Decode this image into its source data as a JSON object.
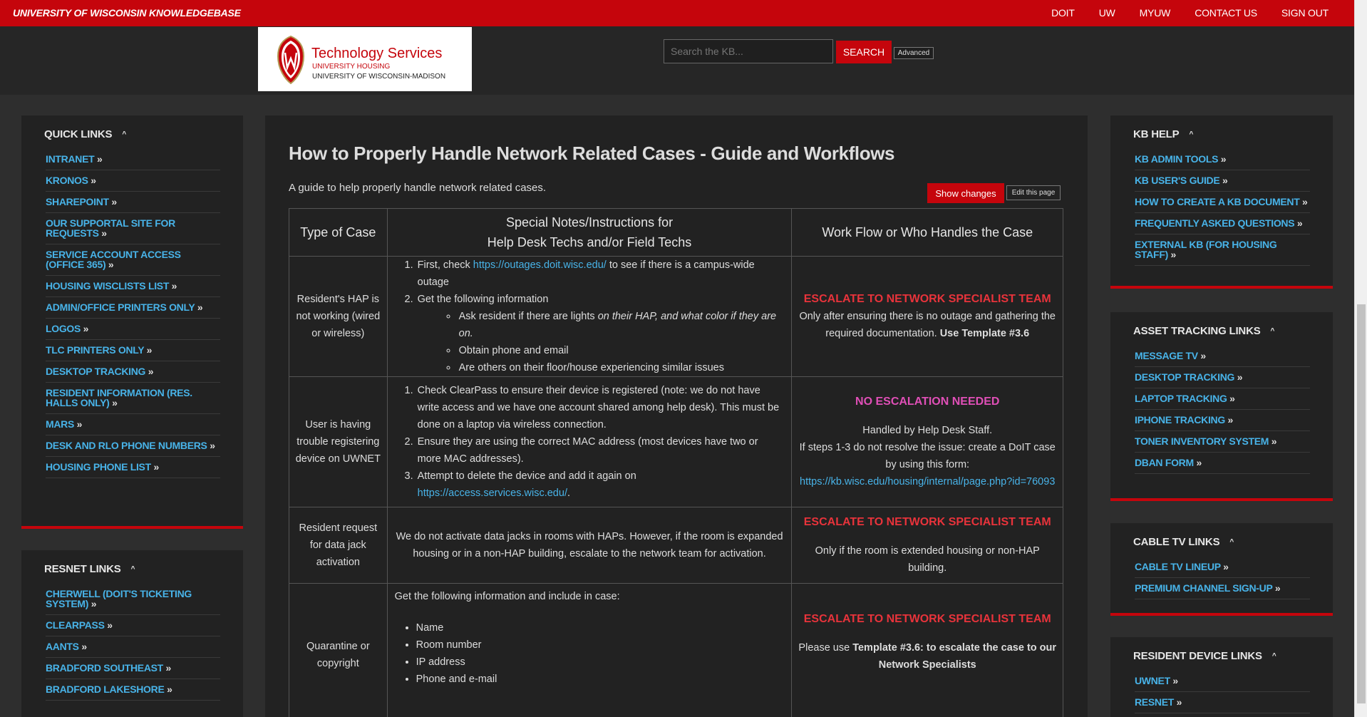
{
  "topbar": {
    "brand": "UNIVERSITY OF WISCONSIN KNOWLEDGEBASE",
    "nav": [
      "DOIT",
      "UW",
      "MYUW",
      "CONTACT US",
      "SIGN OUT"
    ]
  },
  "logo": {
    "line1": "Technology Services",
    "line2": "UNIVERSITY HOUSING",
    "line3": "UNIVERSITY OF WISCONSIN-MADISON"
  },
  "search": {
    "placeholder": "Search the KB...",
    "button": "SEARCH",
    "advanced": "Advanced"
  },
  "left": {
    "quick": {
      "title": "QUICK LINKS",
      "items": [
        "INTRANET",
        "KRONOS",
        "SHAREPOINT",
        "OUR SUPPORTAL SITE FOR REQUESTS",
        "SERVICE ACCOUNT ACCESS (OFFICE 365)",
        "HOUSING WISCLISTS LIST",
        "ADMIN/OFFICE PRINTERS ONLY",
        "LOGOS",
        "TLC PRINTERS ONLY",
        "DESKTOP TRACKING",
        "RESIDENT INFORMATION (RES. HALLS ONLY)",
        "MARS",
        "DESK AND RLO PHONE NUMBERS",
        "HOUSING PHONE LIST"
      ]
    },
    "resnet": {
      "title": "RESNET LINKS",
      "items": [
        "CHERWELL (DOIT'S TICKETING SYSTEM)",
        "CLEARPASS",
        "AANTS",
        "BRADFORD SOUTHEAST",
        "BRADFORD LAKESHORE"
      ]
    }
  },
  "right": {
    "kbhelp": {
      "title": "KB HELP",
      "items": [
        "KB ADMIN TOOLS",
        "KB USER'S GUIDE",
        "HOW TO CREATE A KB DOCUMENT",
        "FREQUENTLY ASKED QUESTIONS",
        "EXTERNAL KB (FOR HOUSING STAFF)"
      ]
    },
    "asset": {
      "title": "ASSET TRACKING LINKS",
      "items": [
        "MESSAGE TV",
        "DESKTOP TRACKING",
        "LAPTOP TRACKING",
        "IPHONE TRACKING",
        "TONER INVENTORY SYSTEM",
        "DBAN FORM"
      ]
    },
    "cabletv": {
      "title": "CABLE TV LINKS",
      "items": [
        "CABLE TV LINEUP",
        "PREMIUM CHANNEL SIGN-UP"
      ]
    },
    "device": {
      "title": "RESIDENT DEVICE LINKS",
      "items": [
        "UWNET",
        "RESNET"
      ]
    }
  },
  "main": {
    "title": "How to Properly Handle Network Related Cases - Guide and Workflows",
    "subtitle": "A guide to help properly handle network related cases.",
    "show_changes": "Show changes",
    "edit_page": "Edit this page",
    "headers": {
      "h1": "Type of Case",
      "h2a": "Special Notes/Instructions for",
      "h2b": "Help Desk Techs and/or Field Techs",
      "h3": "Work Flow or Who Handles the Case"
    },
    "row1": {
      "type": "Resident's HAP is not working (wired or wireless)",
      "s1a": "First, check ",
      "s1link": "https://outages.doit.wisc.edu/",
      "s1b": " to see if there is a campus-wide outage",
      "s2": "Get the following information",
      "sub1a": "Ask resident if there are lights ",
      "sub1b": "on their HAP, and what color if they are on.",
      "sub2": "Obtain phone and email",
      "sub3": "Are others on their floor/house experiencing similar issues",
      "flow_head": "ESCALATE TO NETWORK SPECIALIST TEAM",
      "flow_text": "Only after ensuring there is no outage and gathering the required documentation. ",
      "flow_bold": "Use Template #3.6"
    },
    "row2": {
      "type": "User is having trouble registering device on UWNET",
      "s1": "Check ClearPass to ensure their device is registered (note: we do not have write access and we have one account shared among help desk). This must be done on a laptop via wireless connection.",
      "s2": "Ensure they are using the correct MAC address (most devices have two or more MAC addresses).",
      "s3a": "Attempt to delete the device and add it again on ",
      "s3link": "https://access.services.wisc.edu/",
      "s3b": ".",
      "flow_head": "NO ESCALATION NEEDED",
      "flow_l1": "Handled by Help Desk Staff.",
      "flow_l2": "If steps 1-3 do not resolve the issue: create a DoIT case by using this form:",
      "flow_link": "https://kb.wisc.edu/housing/internal/page.php?id=76093"
    },
    "row3": {
      "type": "Resident request for data jack activation",
      "notes": "We do not activate data jacks in rooms with HAPs. However, if the room is expanded housing or in a non-HAP building, escalate to the network team for activation.",
      "flow_head": "ESCALATE TO NETWORK SPECIALIST TEAM",
      "flow_text": "Only if the room is extended housing or non-HAP building."
    },
    "row4": {
      "type": "Quarantine or copyright",
      "intro": "Get the following information and include in case:",
      "items": [
        "Name",
        "Room number",
        "IP address",
        "Phone and e-mail"
      ],
      "flow_head": "ESCALATE TO NETWORK SPECIALIST TEAM",
      "flow_a": "Please use ",
      "flow_bold": "Template #3.6: to escalate the case to our Network Specialists"
    }
  },
  "colors": {
    "red": "#c5050c",
    "link": "#48b3e8",
    "escalate": "#e8333b",
    "noescalate": "#e04fb7"
  }
}
